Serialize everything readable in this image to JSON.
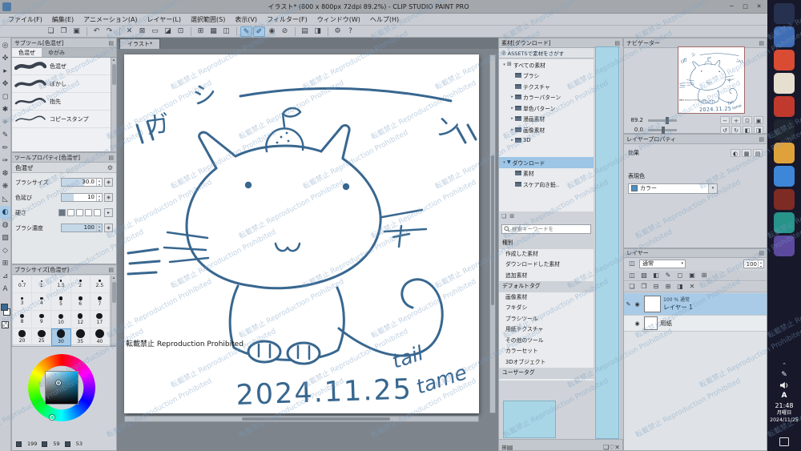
{
  "watermark": {
    "text": "転載禁止 Reproduction Prohibited"
  },
  "titlebar": {
    "title": "イラスト* (800 x 800px 72dpi 89.2%) - CLIP STUDIO PAINT PRO",
    "minimize": "─",
    "maximize": "□",
    "close": "✕"
  },
  "menu": {
    "items": [
      "ファイル(F)",
      "編集(E)",
      "アニメーション(A)",
      "レイヤー(L)",
      "選択範囲(S)",
      "表示(V)",
      "フィルター(F)",
      "ウィンドウ(W)",
      "ヘルプ(H)"
    ]
  },
  "command_bar": {
    "icons": [
      {
        "g": "❏",
        "name": "new-file-icon"
      },
      {
        "g": "❐",
        "name": "open-file-icon"
      },
      {
        "g": "▣",
        "name": "save-icon"
      },
      {
        "sep": true
      },
      {
        "g": "↶",
        "name": "undo-icon"
      },
      {
        "g": "↷",
        "name": "redo-icon"
      },
      {
        "sep": true
      },
      {
        "g": "✕",
        "name": "delete-icon"
      },
      {
        "g": "⊠",
        "name": "delete-outside-selection-icon"
      },
      {
        "g": "▭",
        "name": "deselect-icon"
      },
      {
        "g": "◪",
        "name": "invert-selection-icon"
      },
      {
        "g": "⊡",
        "name": "selection-border-icon"
      },
      {
        "sep": true
      },
      {
        "g": "⊞",
        "name": "grid-icon"
      },
      {
        "g": "▦",
        "name": "snap-to-grid-icon"
      },
      {
        "g": "◫",
        "name": "snap-to-ruler-icon"
      },
      {
        "sep": true
      },
      {
        "g": "✎",
        "name": "snap-special-ruler-icon",
        "sel": true
      },
      {
        "g": "✐",
        "name": "pen-pressure-icon",
        "sel": true
      },
      {
        "g": "◉",
        "name": "light-table-icon"
      },
      {
        "g": "⊘",
        "name": "clear-icon"
      },
      {
        "sep": true
      },
      {
        "g": "▤",
        "name": "show-rulers-icon"
      },
      {
        "g": "◨",
        "name": "flip-view-icon"
      },
      {
        "sep": true
      },
      {
        "g": "⚙",
        "name": "settings-icon"
      },
      {
        "g": "?",
        "name": "help-icon"
      }
    ]
  },
  "tool_strip": {
    "fg_color": "#38678f",
    "bg_color": "#ffffff",
    "tools": [
      {
        "g": "◎",
        "name": "zoom-tool"
      },
      {
        "g": "✜",
        "name": "move-tool"
      },
      {
        "g": "▸",
        "name": "operation-tool"
      },
      {
        "g": "✥",
        "name": "layer-move-tool"
      },
      {
        "g": "◻",
        "name": "selection-tool"
      },
      {
        "g": "✱",
        "name": "auto-select-tool"
      },
      {
        "g": "✧",
        "name": "eyedropper-tool"
      },
      {
        "g": "✎",
        "name": "pen-tool"
      },
      {
        "g": "✏",
        "name": "pencil-tool"
      },
      {
        "g": "✑",
        "name": "brush-tool"
      },
      {
        "g": "❆",
        "name": "airbrush-tool"
      },
      {
        "g": "❋",
        "name": "decoration-tool"
      },
      {
        "g": "◺",
        "name": "eraser-tool"
      },
      {
        "g": "◐",
        "name": "blend-tool",
        "sel": true
      },
      {
        "g": "◍",
        "name": "fill-tool"
      },
      {
        "g": "▨",
        "name": "gradient-tool"
      },
      {
        "g": "◇",
        "name": "figure-tool"
      },
      {
        "g": "⊞",
        "name": "frame-tool"
      },
      {
        "g": "⊿",
        "name": "ruler-tool"
      },
      {
        "g": "A",
        "name": "text-tool"
      }
    ]
  },
  "subtool_panel": {
    "title": "サブツール[色混ぜ]",
    "tabs": [
      {
        "label": "色混ぜ"
      },
      {
        "label": "ゆがみ"
      }
    ],
    "items": [
      "色混ぜ",
      "ぼかし",
      "指先",
      "コピースタンプ"
    ]
  },
  "tool_property": {
    "title": "ツールプロパティ[色混ぜ]",
    "tool_name": "色混ぜ",
    "rows": [
      {
        "label": "ブラシサイズ",
        "value": "30.0"
      },
      {
        "label": "色延び",
        "value": "10"
      },
      {
        "label": "硬さ",
        "value": ""
      },
      {
        "label": "ブラシ濃度",
        "value": "100"
      }
    ]
  },
  "brush_size_panel": {
    "title": "ブラシサイズ[色混ぜ]",
    "sizes": [
      0.7,
      1,
      1.5,
      2,
      2.5,
      3,
      4,
      5,
      6,
      7,
      8,
      9,
      10,
      12,
      17,
      20,
      25,
      30,
      35,
      40
    ],
    "selected": 30
  },
  "color_wheel": {
    "values": [
      "199",
      "59",
      "53"
    ],
    "selected_color": "#38678f",
    "hue_color": "#00a2e8"
  },
  "canvas": {
    "tab": "イラスト*",
    "ink_color": "#38678f",
    "sfx_ga": "ガ",
    "sfx_shi": "シ",
    "sfx_n": "ン",
    "date_text": "2024.11.25",
    "tail_text": "tail",
    "tame_text": "tame",
    "watermark_black": "転載禁止 Reproduction Prohibited"
  },
  "materials_panel": {
    "title": "素材[ダウンロード]",
    "assets_button": "ASSETSで素材をさがす",
    "tree": [
      {
        "label": "すべての素材",
        "depth": 0,
        "icon": "grid",
        "expander": "▾"
      },
      {
        "label": "ブラシ",
        "depth": 1,
        "icon": "folder"
      },
      {
        "label": "テクスチャ",
        "depth": 1,
        "icon": "folder"
      },
      {
        "label": "カラーパターン",
        "depth": 1,
        "icon": "folder",
        "expander": "▸"
      },
      {
        "label": "単色パターン",
        "depth": 1,
        "icon": "folder",
        "expander": "▸"
      },
      {
        "label": "漫画素材",
        "depth": 1,
        "icon": "folder",
        "expander": "▸"
      },
      {
        "label": "画像素材",
        "depth": 1,
        "icon": "folder",
        "expander": "▸"
      },
      {
        "label": "3D",
        "depth": 1,
        "icon": "folder",
        "expander": "▸"
      },
      {
        "label": "ダウンロード",
        "depth": 0,
        "icon": "download",
        "expander": "▾",
        "selected": true,
        "gap": true
      },
      {
        "label": "素材",
        "depth": 1,
        "icon": "folder"
      },
      {
        "label": "スケア向き鉛..",
        "depth": 1,
        "icon": "folder"
      }
    ],
    "search_placeholder": "検索キーワードを",
    "filters": [
      {
        "label": "種別",
        "header": true
      },
      {
        "label": "作成した素材"
      },
      {
        "label": "ダウンロードした素材"
      },
      {
        "label": "追加素材"
      },
      {
        "label": "デフォルトタグ",
        "header": true
      },
      {
        "label": "画像素材"
      },
      {
        "label": "フキダシ"
      },
      {
        "label": "ブラシツール"
      },
      {
        "label": "用紙テクスチャ"
      },
      {
        "label": "その他のツール"
      },
      {
        "label": "カラーセット"
      },
      {
        "label": "3Dオブジェクト"
      },
      {
        "label": "ユーザータグ",
        "header": true
      }
    ],
    "bottom_left_icons": [
      {
        "g": "⊞",
        "name": "thumbnail-view-icon"
      },
      {
        "g": "▤",
        "name": "list-view-icon"
      }
    ],
    "bottom_right_icons": [
      {
        "g": "❏",
        "name": "new-material-icon"
      },
      {
        "g": "♡",
        "name": "favorite-icon"
      },
      {
        "g": "✕",
        "name": "delete-material-icon"
      }
    ]
  },
  "navigator": {
    "title": "ナビゲーター",
    "zoom": "89.2",
    "rotation": "0.0",
    "zoom_icons": [
      {
        "g": "−",
        "name": "zoom-out-icon"
      },
      {
        "g": "+",
        "name": "zoom-in-icon"
      },
      {
        "g": "⊡",
        "name": "fit-to-screen-icon"
      },
      {
        "g": "▣",
        "name": "actual-size-icon"
      }
    ],
    "rotate_icons": [
      {
        "g": "↺",
        "name": "rotate-left-icon"
      },
      {
        "g": "↻",
        "name": "rotate-right-icon"
      },
      {
        "g": "◧",
        "name": "flip-horizontal-icon"
      },
      {
        "g": "◨",
        "name": "flip-vertical-icon"
      }
    ]
  },
  "layer_property": {
    "title": "レイヤープロパティ",
    "effect_label": "効果",
    "effect_icons": [
      {
        "g": "◐",
        "name": "border-effect-icon"
      },
      {
        "g": "▩",
        "name": "tone-icon"
      },
      {
        "g": "▤",
        "name": "layer-color-icon"
      }
    ],
    "expression_label": "表現色",
    "expression_value": "カラー"
  },
  "layer_panel": {
    "title": "レイヤー",
    "blend_mode": "通常",
    "opacity": "100",
    "icon_row1": [
      {
        "g": "◫",
        "name": "clip-below-icon"
      },
      {
        "g": "▨",
        "name": "lock-layer-icon"
      },
      {
        "g": "◧",
        "name": "lock-transparent-icon"
      },
      {
        "g": "✎",
        "name": "draft-layer-icon"
      },
      {
        "g": "◻",
        "name": "enable-mask-icon"
      },
      {
        "g": "▣",
        "name": "reference-layer-icon"
      },
      {
        "g": "⊞",
        "name": "ruler-icon"
      }
    ],
    "icon_row2": [
      {
        "g": "❏",
        "name": "new-layer-icon"
      },
      {
        "g": "❐",
        "name": "new-folder-icon"
      },
      {
        "g": "⊟",
        "name": "merge-down-icon"
      },
      {
        "g": "⊞",
        "name": "combine-icon"
      },
      {
        "g": "◨",
        "name": "transfer-icon"
      },
      {
        "g": "✕",
        "name": "delete-layer-icon"
      }
    ],
    "layers": [
      {
        "name": "レイヤー 1",
        "meta": "100 % 通常",
        "selected": true
      },
      {
        "name": "用紙",
        "meta": "",
        "selected": false
      }
    ]
  },
  "taskbar": {
    "apps": [
      {
        "color": "#26314f"
      },
      {
        "color": "#3f6db5"
      },
      {
        "color": "#d94b33"
      },
      {
        "color": "#e6dfd0"
      },
      {
        "color": "#bf392d"
      },
      {
        "color": "#20262f"
      },
      {
        "color": "#dfa23b"
      },
      {
        "color": "#3e86d8"
      },
      {
        "color": "#7e2b24"
      },
      {
        "color": "#27938a"
      },
      {
        "color": "#5c4a9e"
      }
    ],
    "ime": "A",
    "time": "21:48",
    "weekday": "月曜日",
    "date": "2024/11/25"
  }
}
